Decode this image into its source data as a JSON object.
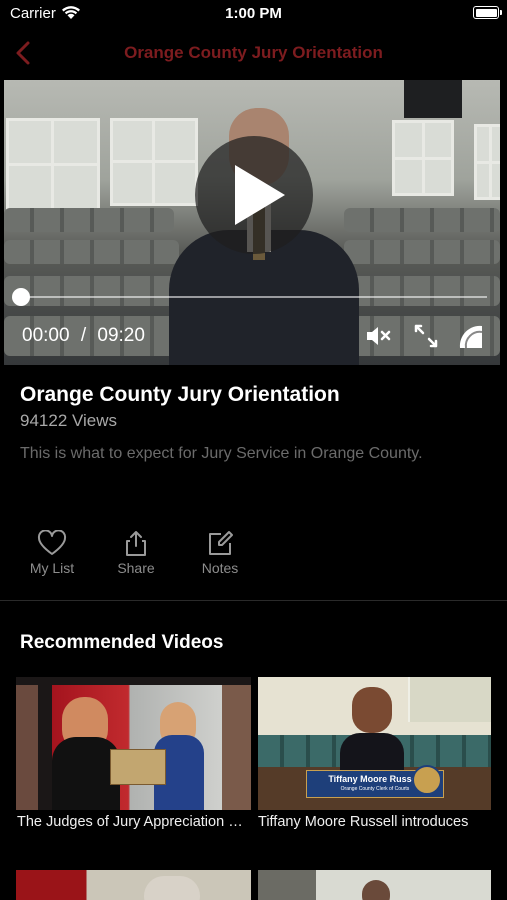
{
  "status_bar": {
    "carrier": "Carrier",
    "time": "1:00 PM"
  },
  "nav": {
    "title": "Orange County Jury Orientation"
  },
  "player": {
    "elapsed": "00:00",
    "separator": "/",
    "duration": "09:20",
    "progress": 0
  },
  "video": {
    "title": "Orange County Jury Orientation",
    "views": "94122 Views",
    "description": "This is what to expect for Jury Service in Orange County."
  },
  "actions": [
    {
      "label": "My List",
      "icon": "heart-icon"
    },
    {
      "label": "Share",
      "icon": "share-icon"
    },
    {
      "label": "Notes",
      "icon": "edit-icon"
    }
  ],
  "recommended": {
    "title": "Recommended Videos",
    "items": [
      {
        "caption": "The Judges of Jury Appreciation Week",
        "overlay_text": ""
      },
      {
        "caption": "Tiffany Moore Russell introduces",
        "overlay_name": "Tiffany Moore Russell",
        "overlay_role": "Orange County Clerk of Courts"
      }
    ]
  },
  "colors": {
    "accent": "#7d1c1f",
    "background": "#000000"
  }
}
